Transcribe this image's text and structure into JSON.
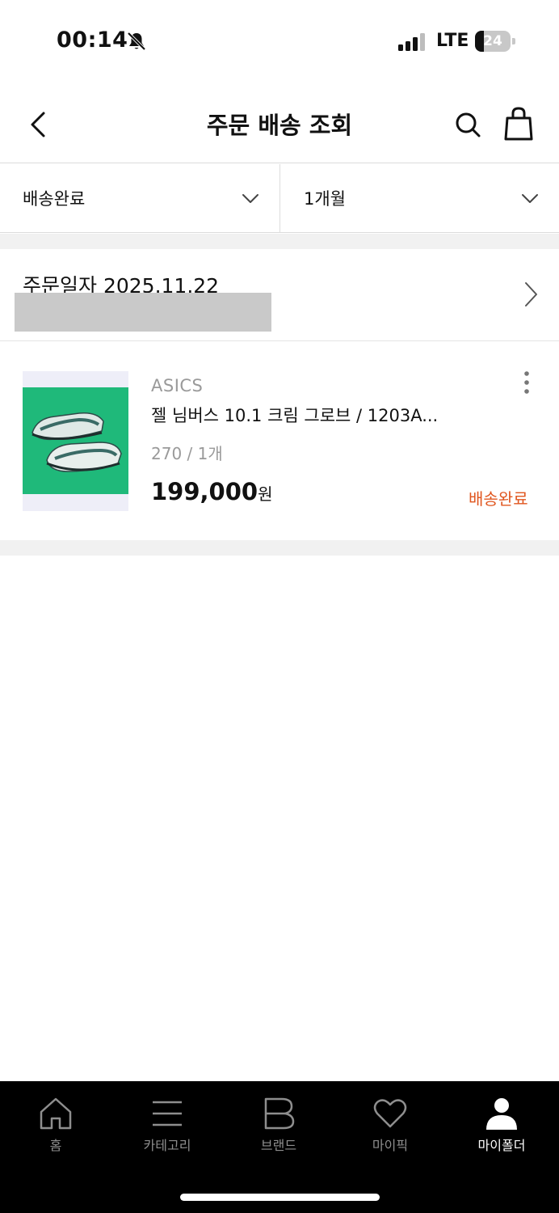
{
  "status_bar": {
    "time": "00:14",
    "network": "LTE",
    "battery": "24",
    "battery_level_percent": 24
  },
  "header": {
    "title": "주문 배송 조회",
    "icons": [
      "back-icon",
      "search-icon",
      "cart-icon"
    ]
  },
  "filters": {
    "status_value": "배송완료",
    "period_value": "1개월"
  },
  "order": {
    "date_label": "주문일자 2025.11.22"
  },
  "product": {
    "brand": "ASICS",
    "name": "젤 님버스 10.1 크림 그로브 / 1203A...",
    "option": "270 / 1개",
    "price": "199,000",
    "price_unit": "원",
    "status": "배송완료",
    "status_color": "#e0561f",
    "thumbnail_bg": "#1fb97a"
  },
  "bottom_nav": {
    "items": [
      {
        "label": "홈",
        "icon": "home-icon"
      },
      {
        "label": "카테고리",
        "icon": "menu-icon"
      },
      {
        "label": "브랜드",
        "icon": "brand-icon"
      },
      {
        "label": "마이픽",
        "icon": "heart-icon"
      },
      {
        "label": "마이폴더",
        "icon": "person-icon",
        "active": true
      }
    ]
  }
}
